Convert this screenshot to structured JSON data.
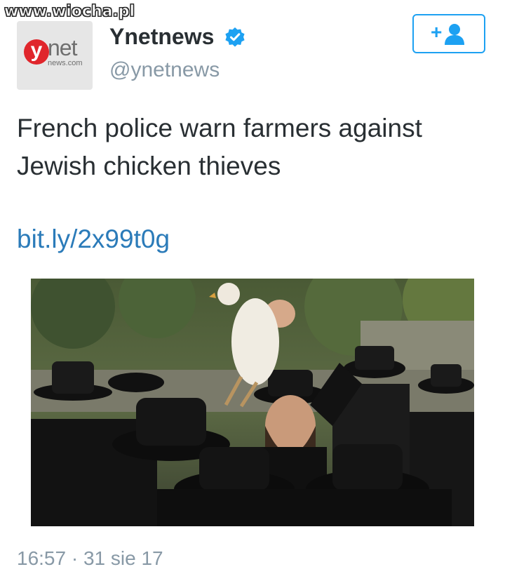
{
  "watermark": "www.wiocha.pl",
  "account": {
    "avatar": {
      "logo_y": "y",
      "logo_net": "net",
      "logo_domain": "news.com"
    },
    "display_name": "Ynetnews",
    "handle": "@ynetnews",
    "verified": true
  },
  "follow_button": {
    "symbol": "+",
    "icon": "add-user-icon",
    "color": "#1da1f2"
  },
  "tweet": {
    "text": "French police warn farmers against Jewish chicken thieves",
    "link": "bit.ly/2x99t0g",
    "link_color": "#2b7bb9",
    "timestamp": "16:57 · 31 sie 17"
  },
  "photo": {
    "icon": "photo-image"
  },
  "colors": {
    "text": "#292f33",
    "secondary": "#8899a6",
    "brand_red": "#e0262c"
  }
}
